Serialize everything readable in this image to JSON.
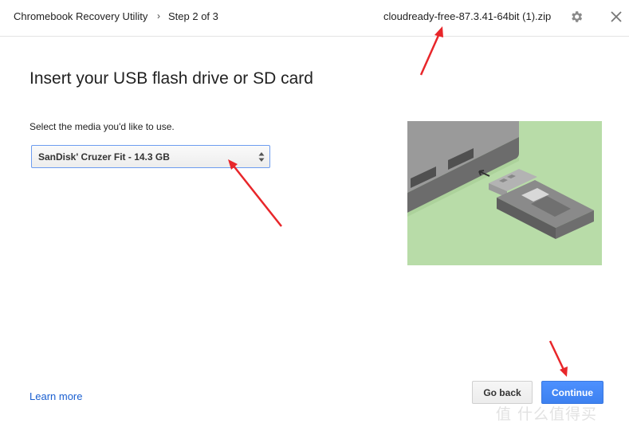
{
  "header": {
    "app_title": "Chromebook Recovery Utility",
    "breadcrumb_separator": "›",
    "step": "Step 2 of 3",
    "filename": "cloudready-free-87.3.41-64bit (1).zip",
    "settings_icon": "gear-icon",
    "close_icon": "close-icon"
  },
  "main": {
    "title": "Insert your USB flash drive or SD card",
    "prompt": "Select the media you'd like to use.",
    "media_select": {
      "selected_value": "SanDisk' Cruzer Fit - 14.3 GB"
    },
    "illustration": "usb-drive-insert-illustration"
  },
  "footer": {
    "learn_more": "Learn more",
    "go_back": "Go back",
    "continue": "Continue"
  },
  "overlay": {
    "watermark": "值 什么值得买",
    "annotation_color": "#e8262a"
  },
  "colors": {
    "accent_blue": "#4d90fe",
    "link_blue": "#1a5fd0",
    "illustration_bg": "#b8dca8"
  }
}
